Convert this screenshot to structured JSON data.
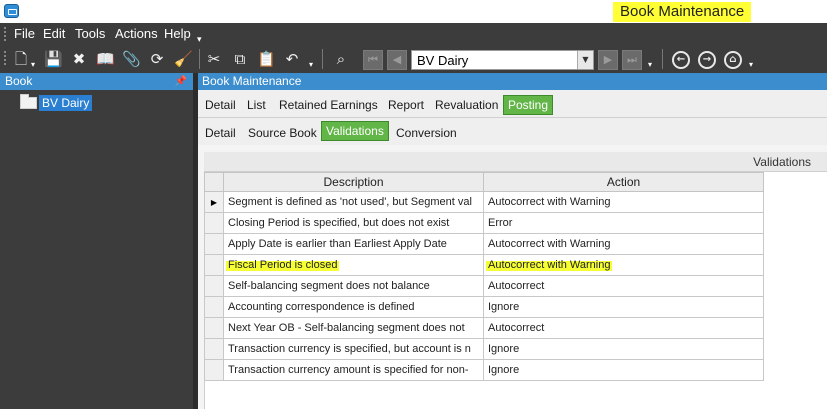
{
  "window": {
    "title": "Book Maintenance"
  },
  "menu": {
    "items": [
      "File",
      "Edit",
      "Tools",
      "Actions",
      "Help"
    ]
  },
  "toolbar": {
    "book_selector_value": "BV Dairy",
    "icons": [
      "new-icon",
      "save-icon",
      "delete-icon",
      "book-icon",
      "attach-icon",
      "refresh-icon",
      "clear-icon",
      "cut-icon",
      "copy-icon",
      "paste-icon",
      "undo-icon",
      "search-binoculars-icon",
      "first-icon",
      "prev-icon",
      "next-icon",
      "last-icon",
      "back-icon",
      "forward-icon",
      "home-icon"
    ]
  },
  "left_panel": {
    "title": "Book",
    "tree": [
      {
        "label": "BV Dairy"
      }
    ]
  },
  "right_panel": {
    "title": "Book Maintenance",
    "tabs_primary": [
      {
        "label": "Detail",
        "active": false
      },
      {
        "label": "List",
        "active": false
      },
      {
        "label": "Retained Earnings",
        "active": false
      },
      {
        "label": "Report",
        "active": false
      },
      {
        "label": "Revaluation",
        "active": false
      },
      {
        "label": "Posting",
        "active": true
      }
    ],
    "tabs_secondary": [
      {
        "label": "Detail",
        "active": false
      },
      {
        "label": "Source Book",
        "active": false
      },
      {
        "label": "Validations",
        "active": true
      },
      {
        "label": "Conversion",
        "active": false
      }
    ],
    "grid": {
      "caption": "Validations",
      "columns": [
        "Description",
        "Action"
      ],
      "rows": [
        {
          "description": "Segment is defined as 'not used', but Segment val",
          "action": "Autocorrect with Warning",
          "current": true
        },
        {
          "description": "Closing Period is specified, but does not exist",
          "action": "Error"
        },
        {
          "description": "Apply Date is earlier than Earliest Apply Date",
          "action": "Autocorrect with Warning"
        },
        {
          "description": "Fiscal Period is closed",
          "action": "Autocorrect with Warning",
          "highlighted": true
        },
        {
          "description": "Self-balancing segment does not balance",
          "action": "Autocorrect"
        },
        {
          "description": "Accounting correspondence is defined",
          "action": "Ignore"
        },
        {
          "description": "Next Year OB - Self-balancing segment does not",
          "action": "Autocorrect"
        },
        {
          "description": "Transaction currency is specified, but account is n",
          "action": "Ignore"
        },
        {
          "description": "Transaction currency amount is specified for non-",
          "action": "Ignore"
        }
      ]
    }
  },
  "colors": {
    "accent_blue": "#3b8dcd",
    "active_tab_green": "#62b547",
    "highlight_yellow": "#ffff33",
    "chrome_dark": "#3c3c3c"
  }
}
